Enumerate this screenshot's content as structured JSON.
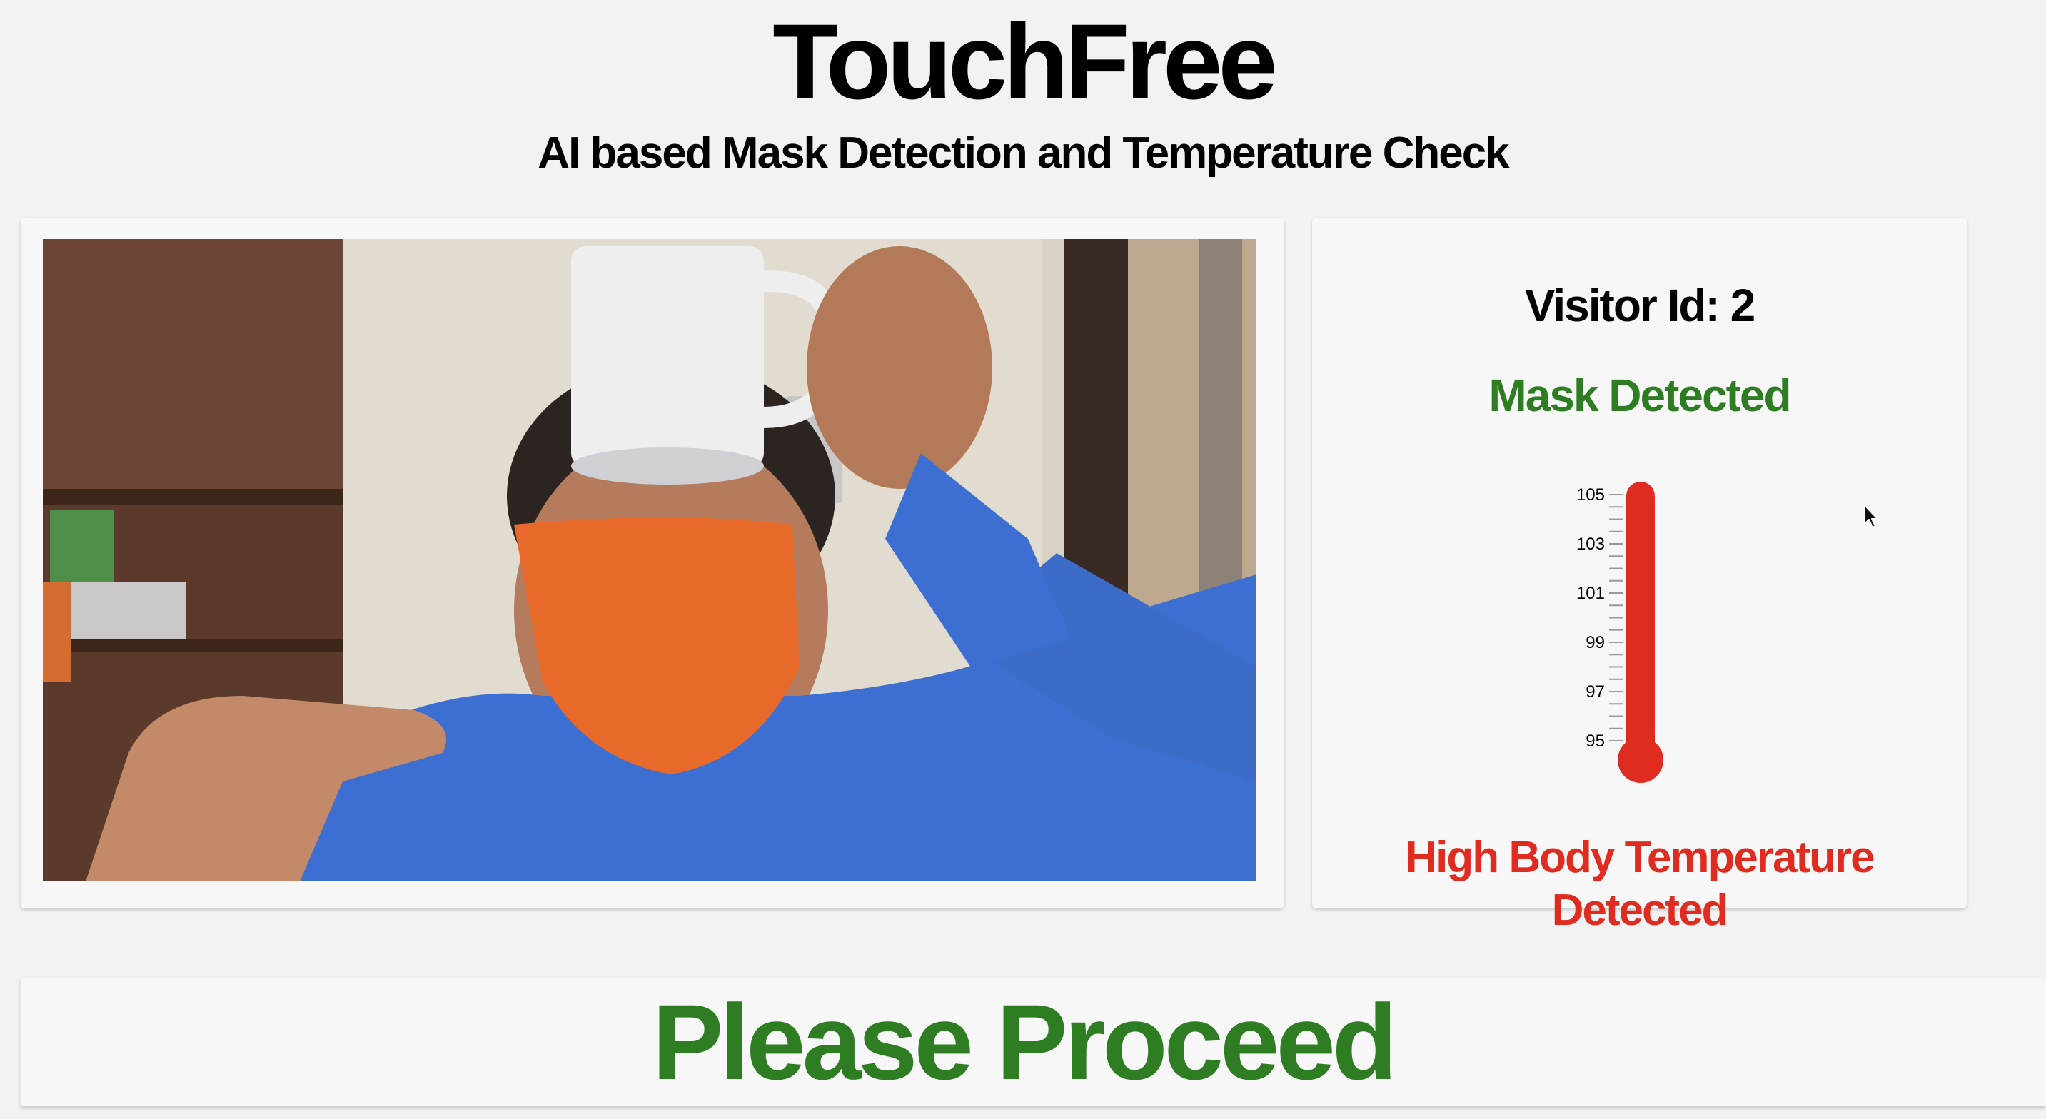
{
  "header": {
    "title": "TouchFree",
    "subtitle": "AI based Mask Detection and Temperature Check"
  },
  "visitor": {
    "id_label": "Visitor Id: 2",
    "mask_status": "Mask Detected",
    "temperature_status": "High Body Temperature Detected"
  },
  "thermometer": {
    "ticks": [
      "105",
      "103",
      "101",
      "99",
      "97",
      "95"
    ],
    "min": 95,
    "max": 105,
    "level": 1.0,
    "colors": {
      "fill": "#e02b20",
      "tick": "#999999"
    }
  },
  "footer": {
    "message": "Please Proceed"
  },
  "colors": {
    "ok": "#2e7d23",
    "alert": "#e02b20"
  },
  "icons": {
    "cursor": "mouse-pointer-icon"
  }
}
